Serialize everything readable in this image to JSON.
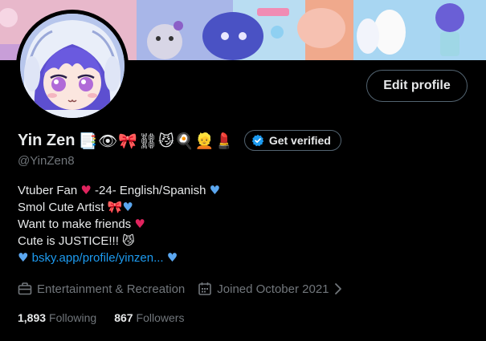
{
  "profile": {
    "display_name": "Yin Zen",
    "name_emojis": "📑👁🎀⛓😼🍳👱💄",
    "handle": "@YinZen8",
    "edit_profile_label": "Edit profile",
    "get_verified_label": "Get verified"
  },
  "bio": {
    "line1_text": "Vtuber Fan",
    "line1_mid": "-24- English/Spanish",
    "line2_text": "Smol Cute Artist",
    "line3_text": "Want to make friends",
    "line4_text": "Cute is JUSTICE!!!",
    "link_text": "bsky.app/profile/yinzen..."
  },
  "meta": {
    "category": "Entertainment & Recreation",
    "joined": "Joined October 2021"
  },
  "counts": {
    "following_count": "1,893",
    "following_label": "Following",
    "followers_count": "867",
    "followers_label": "Followers"
  },
  "colors": {
    "background": "#000000",
    "text_primary": "#e7e9ea",
    "text_secondary": "#71767b",
    "link": "#1d9bf0",
    "border": "#536471"
  },
  "icons": {
    "verified": "verified-badge-icon",
    "category": "briefcase-icon",
    "joined": "calendar-icon",
    "chevron": "chevron-right-icon"
  }
}
